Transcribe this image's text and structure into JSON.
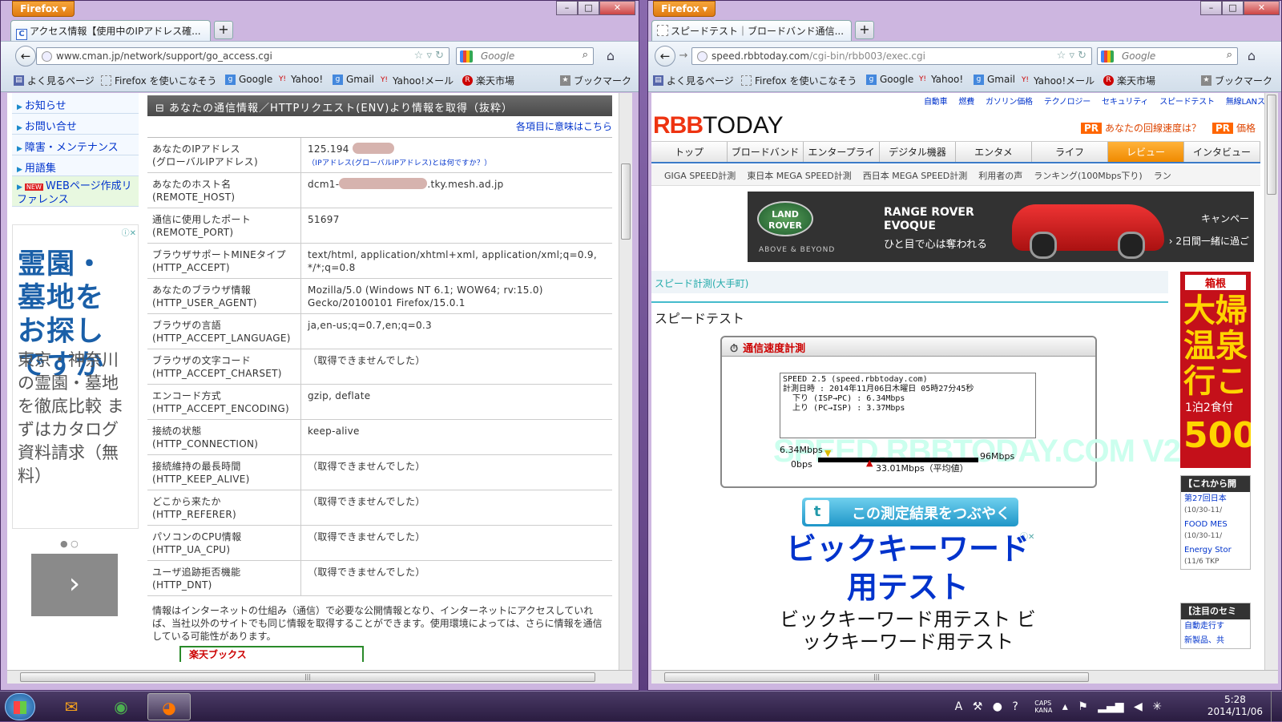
{
  "left_window": {
    "app_button": "Firefox",
    "tab_title": "アクセス情報【使用中のIPアドレス確...",
    "url": "www.cman.jp/network/support/go_access.cgi",
    "search_placeholder": "Google",
    "bookmarks": [
      "よく見るページ",
      "Firefox を使いこなそう",
      "Google",
      "Yahoo!",
      "Gmail",
      "Yahoo!メール",
      "楽天市場",
      "ブックマーク"
    ],
    "side_nav": [
      "お知らせ",
      "お問い合せ",
      "障害・メンテナンス",
      "用語集"
    ],
    "side_nav_new": "NEW",
    "side_nav_webref": "WEBページ作成リファレンス",
    "ad_big": "霊園・墓地をお探しですか",
    "ad_small": "東京・神奈川の霊園・墓地を徹底比較 まずはカタログ資料請求（無料）",
    "ad_dots": "● ○",
    "ad_next": "›",
    "section_title": "あなたの通信情報／HTTPリクエスト(ENV)より情報を取得（抜粋）",
    "meaning_link": "各項目に意味はこちら",
    "rows": [
      {
        "k1": "あなたのIPアドレス",
        "k2": "(グローバルIPアドレス)",
        "v1": "125.194",
        "v2": "（IPアドレス(グローバルIPアドレス)とは何ですか？）"
      },
      {
        "k1": "あなたのホスト名",
        "k2": "(REMOTE_HOST)",
        "v1": "dcm1-",
        "v1b": ".tky.mesh.ad.jp"
      },
      {
        "k1": "通信に使用したポート",
        "k2": "(REMOTE_PORT)",
        "v1": "51697"
      },
      {
        "k1": "ブラウザサポートMINEタイプ",
        "k2": "(HTTP_ACCEPT)",
        "v1": "text/html, application/xhtml+xml, application/xml;q=0.9,",
        "v2": "*/*;q=0.8"
      },
      {
        "k1": "あなたのブラウザ情報",
        "k2": "(HTTP_USER_AGENT)",
        "v1": "Mozilla/5.0 (Windows NT 6.1; WOW64; rv:15.0)",
        "v2": "Gecko/20100101 Firefox/15.0.1"
      },
      {
        "k1": "ブラウザの言語",
        "k2": "(HTTP_ACCEPT_LANGUAGE)",
        "v1": "ja,en-us;q=0.7,en;q=0.3"
      },
      {
        "k1": "ブラウザの文字コード",
        "k2": "(HTTP_ACCEPT_CHARSET)",
        "v1": "（取得できませんでした）"
      },
      {
        "k1": "エンコード方式",
        "k2": "(HTTP_ACCEPT_ENCODING)",
        "v1": "gzip, deflate"
      },
      {
        "k1": "接続の状態",
        "k2": "(HTTP_CONNECTION)",
        "v1": "keep-alive"
      },
      {
        "k1": "接続維持の最長時間",
        "k2": "(HTTP_KEEP_ALIVE)",
        "v1": "（取得できませんでした）"
      },
      {
        "k1": "どこから来たか",
        "k2": "(HTTP_REFERER)",
        "v1": "（取得できませんでした）"
      },
      {
        "k1": "パソコンのCPU情報",
        "k2": "(HTTP_UA_CPU)",
        "v1": "（取得できませんでした）"
      },
      {
        "k1": "ユーザ追跡拒否機能",
        "k2": "(HTTP_DNT)",
        "v1": "（取得できませんでした）"
      }
    ],
    "note": "情報はインターネットの仕組み（通信）で必要な公開情報となり、インターネットにアクセスしていれば、当社以外のサイトでも同じ情報を取得することができます。使用環境によっては、さらに情報を通信している可能性があります。",
    "bottom_ad": "楽天ブックス"
  },
  "right_window": {
    "app_button": "Firefox",
    "tab_title": "スピードテスト｜ブロードバンド通信...",
    "url_host": "speed.rbbtoday.com",
    "url_path": "/cgi-bin/rbb003/exec.cgi",
    "search_placeholder": "Google",
    "bookmarks": [
      "よく見るページ",
      "Firefox を使いこなそう",
      "Google",
      "Yahoo!",
      "Gmail",
      "Yahoo!メール",
      "楽天市場",
      "ブックマーク"
    ],
    "top_nav": [
      "自動車",
      "燃費",
      "ガソリン価格",
      "テクノロジー",
      "セキュリティ",
      "スピードテスト",
      "無線LANスポット"
    ],
    "logo_rbb": "RBB",
    "logo_today": "TODAY",
    "pr1": "あなたの回線速度は？",
    "pr2": "価格",
    "pr_tag": "PR",
    "tabs": [
      "トップ",
      "ブロードバンド",
      "エンタープライズ",
      "デジタル機器",
      "エンタメ",
      "ライフ",
      "レビュー",
      "インタビュー"
    ],
    "sub_nav": [
      "GIGA SPEED計測",
      "東日本 MEGA SPEED計測",
      "西日本 MEGA SPEED計測",
      "利用者の声",
      "ランキング(100Mbps下り)",
      "ラン"
    ],
    "banner_brand": "LAND ROVER",
    "banner_tag": "ABOVE & BEYOND",
    "banner_model1": "RANGE ROVER",
    "banner_model2": "EVOQUE",
    "banner_copy": "ひと目で心は奪われる",
    "banner_camp1": "キャンペー",
    "banner_camp2": "› 2日間一緒に過ご",
    "speed_link": "スピード計測(大手町)",
    "speed_heading": "スピードテスト",
    "meter_title": "通信速度計測",
    "result_line1": "SPEED 2.5 (speed.rbbtoday.com)",
    "result_line2": "計測日時 : 2014年11月06日木曜日 05時27分45秒",
    "result_line3": "  下り (ISP→PC) : 6.34Mbps",
    "result_line4": "  上り (PC→ISP) : 3.37Mbps",
    "watermark": "SPEED.RBBTODAY.COM V2.5",
    "gauge_current": "6.34Mbps",
    "gauge_min": "0bps",
    "gauge_max": "96Mbps",
    "gauge_avg": "33.01Mbps（平均値）",
    "tweet_button": "この測定結果をつぶやく",
    "ad_title": "ビックキーワード用テスト",
    "ad_body": "ビックキーワード用テスト ビックキーワード用テスト",
    "side_ad_head": "箱根",
    "side_ad_big": "大婦温泉行こ",
    "side_ad_small": "1泊2食付",
    "side_ad_num": "500",
    "box1_title": "【これから開",
    "box1_items": [
      {
        "t": "第27回日本",
        "d": "(10/30-11/"
      },
      {
        "t": "FOOD MES",
        "d": "(10/30-11/"
      },
      {
        "t": "Energy Stor",
        "d": "(11/6 TKP"
      }
    ],
    "box2_title": "【注目のセミ",
    "box2_items": [
      "自動走行す",
      "新製品、共"
    ]
  },
  "taskbar": {
    "clock_time": "5:28",
    "clock_date": "2014/11/06",
    "caps": "CAPS",
    "kana": "KANA",
    "ime": "A"
  }
}
